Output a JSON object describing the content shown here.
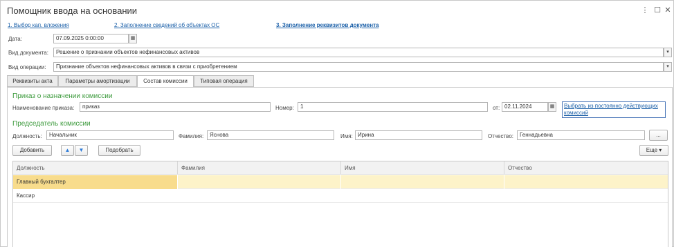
{
  "window": {
    "title": "Помощник ввода на основании",
    "menu_icon": "⋮",
    "maximize_icon": "☐",
    "close_icon": "✕"
  },
  "steps": [
    "1. Выбор кап. вложения",
    "2. Заполнение сведений об объектах ОС",
    "3. Заполнение реквизитов документа"
  ],
  "form": {
    "date_label": "Дата:",
    "date_value": "07.09.2025  0:00:00",
    "doc_type_label": "Вид документа:",
    "doc_type_value": "Решение о признании объектов нефинансовых активов",
    "op_type_label": "Вид операции:",
    "op_type_value": "Признание объектов нефинансовых активов в связи с приобретением"
  },
  "tabs": [
    "Реквизиты акта",
    "Параметры амортизации",
    "Состав комиссии",
    "Типовая операция"
  ],
  "order": {
    "section_title": "Приказ о назначении комиссии",
    "name_label": "Наименование приказа:",
    "name_value": "приказ",
    "number_label": "Номер:",
    "number_value": "1",
    "from_label": "от:",
    "date_value": "02.11.2024",
    "choose_link": "Выбрать из постоянно действующих комиссий"
  },
  "chairman": {
    "section_title": "Председатель комиссии",
    "position_label": "Должность:",
    "position_value": "Начальник",
    "surname_label": "Фамилия:",
    "surname_value": "Яснова",
    "name_label": "Имя:",
    "name_value": "Ирина",
    "patronymic_label": "Отчество:",
    "patronymic_value": "Геннадьевна",
    "more_button": "..."
  },
  "toolbar": {
    "add_label": "Добавить",
    "pick_label": "Подобрать",
    "more_label": "Еще"
  },
  "table": {
    "columns": [
      "Должность",
      "Фамилия",
      "Имя",
      "Отчество"
    ],
    "rows": [
      [
        "Главный бухгалтер",
        "",
        "",
        ""
      ],
      [
        "Кассир",
        "",
        "",
        ""
      ]
    ]
  }
}
